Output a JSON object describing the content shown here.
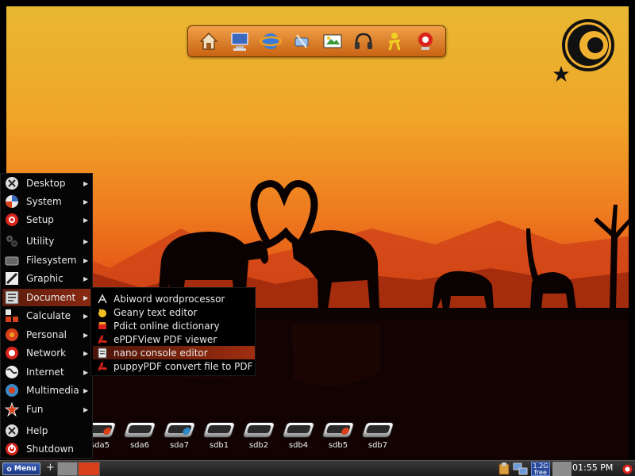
{
  "launcher": {
    "icons": [
      "home-icon",
      "computer-icon",
      "browser-icon",
      "network-icon",
      "paint-icon",
      "music-icon",
      "user-icon",
      "webcam-icon"
    ]
  },
  "main_menu": {
    "items": [
      {
        "label": "Desktop",
        "icon": "desktop-icon",
        "has_submenu": true
      },
      {
        "label": "System",
        "icon": "system-icon",
        "has_submenu": true
      },
      {
        "label": "Setup",
        "icon": "setup-icon",
        "has_submenu": true
      },
      {
        "label": "Utility",
        "icon": "utility-icon",
        "has_submenu": true
      },
      {
        "label": "Filesystem",
        "icon": "filesystem-icon",
        "has_submenu": true
      },
      {
        "label": "Graphic",
        "icon": "graphic-icon",
        "has_submenu": true
      },
      {
        "label": "Document",
        "icon": "document-icon",
        "has_submenu": true
      },
      {
        "label": "Calculate",
        "icon": "calculate-icon",
        "has_submenu": true
      },
      {
        "label": "Personal",
        "icon": "personal-icon",
        "has_submenu": true
      },
      {
        "label": "Network",
        "icon": "network-icon",
        "has_submenu": true
      },
      {
        "label": "Internet",
        "icon": "internet-icon",
        "has_submenu": true
      },
      {
        "label": "Multimedia",
        "icon": "multimedia-icon",
        "has_submenu": true
      },
      {
        "label": "Fun",
        "icon": "fun-icon",
        "has_submenu": true
      },
      {
        "label": "Help",
        "icon": "help-icon",
        "has_submenu": false
      },
      {
        "label": "Shutdown",
        "icon": "shutdown-icon",
        "has_submenu": false
      }
    ],
    "active": "Document"
  },
  "document_submenu": {
    "items": [
      {
        "label": "Abiword wordprocessor",
        "icon": "abiword-icon"
      },
      {
        "label": "Geany text editor",
        "icon": "geany-icon"
      },
      {
        "label": "Pdict online dictionary",
        "icon": "dictionary-icon"
      },
      {
        "label": "ePDFView PDF viewer",
        "icon": "pdf-icon"
      },
      {
        "label": "nano console editor",
        "icon": "nano-icon"
      },
      {
        "label": "puppyPDF convert file to PDF",
        "icon": "pdf-convert-icon"
      }
    ],
    "active": "nano console editor"
  },
  "drives": [
    {
      "label": "sda5",
      "dot": "#d8401c"
    },
    {
      "label": "sda6",
      "dot": ""
    },
    {
      "label": "sda7",
      "dot": "#2a8ac8"
    },
    {
      "label": "sdb1",
      "dot": ""
    },
    {
      "label": "sdb2",
      "dot": ""
    },
    {
      "label": "sdb4",
      "dot": ""
    },
    {
      "label": "sdb5",
      "dot": "#d8401c"
    },
    {
      "label": "sdb7",
      "dot": ""
    }
  ],
  "taskbar": {
    "menu_label": "Menu",
    "plus_label": "+",
    "free_space_line1": "1.2G",
    "free_space_line2": "free",
    "clock": "01:55 PM"
  }
}
